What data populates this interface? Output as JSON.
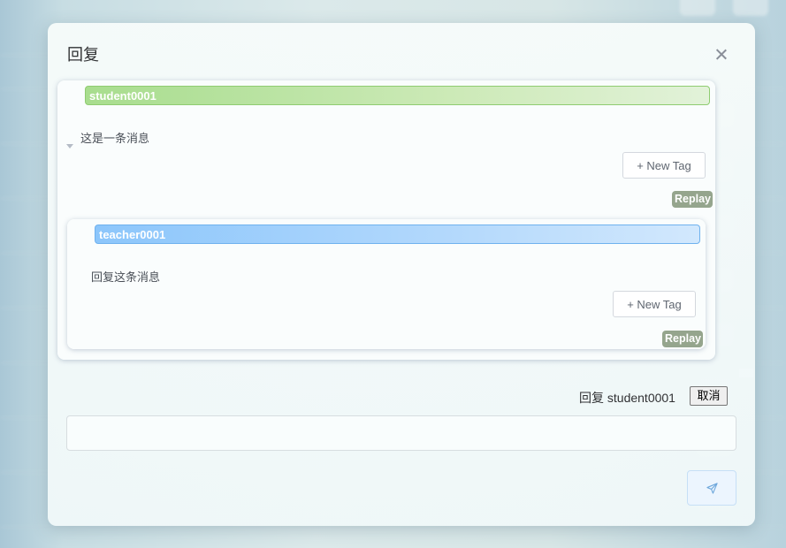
{
  "dialog": {
    "title": "回复",
    "close_icon": "close-icon"
  },
  "thread": {
    "author": "student0001",
    "message": "这是一条消息",
    "new_tag_label": "+ New Tag",
    "replay_label": "Replay",
    "reply": {
      "author": "teacher0001",
      "message": "回复这条消息",
      "new_tag_label": "+ New Tag",
      "replay_label": "Replay"
    }
  },
  "composer": {
    "replying_to_text": "回复 student0001",
    "cancel_label": "取消",
    "input_value": "",
    "input_placeholder": "",
    "send_icon": "send-icon"
  },
  "colors": {
    "student_bar": "#a8dd8e",
    "teacher_bar": "#8cc6fb",
    "replay_badge": "#95a58d"
  }
}
